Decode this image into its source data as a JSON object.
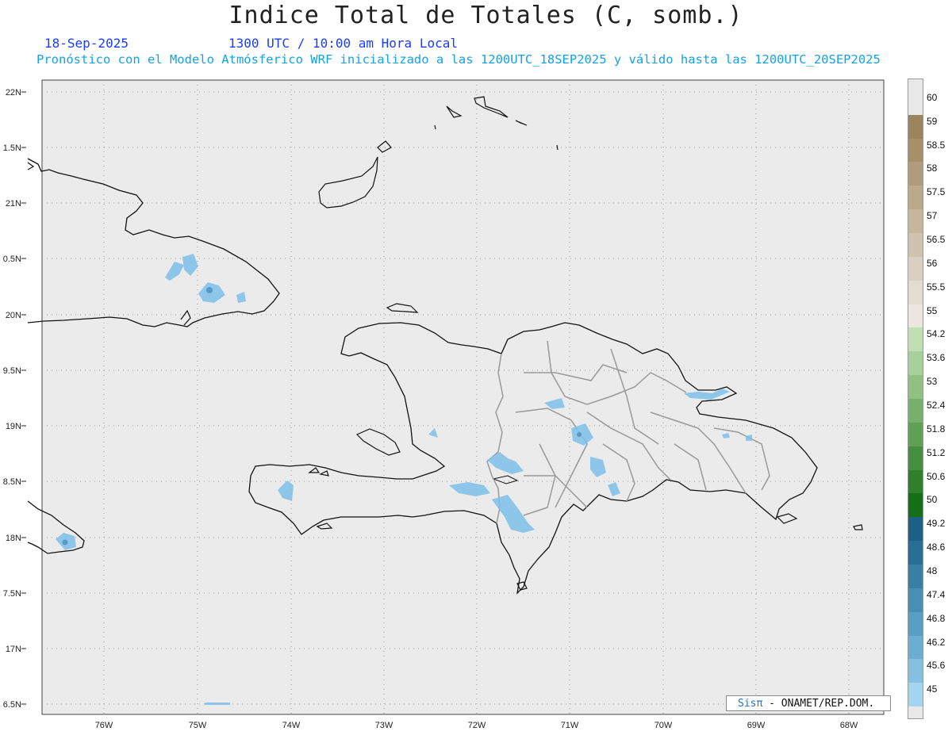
{
  "title": "Indice Total de Totales (C, somb.)",
  "date": "18-Sep-2025",
  "time": "1300 UTC / 10:00 am Hora Local",
  "description": "Pronóstico con el Modelo Atmósferico WRF inicializado a las 1200UTC_18SEP2025 y válido hasta las  1200UTC_20SEP2025",
  "credit": {
    "brand": "Sisπ",
    "rest": "- ONAMET/REP.DOM."
  },
  "lat_labels": [
    "22N",
    "1.5N",
    "21N",
    "0.5N",
    "20N",
    "9.5N",
    "19N",
    "8.5N",
    "18N",
    "7.5N",
    "17N",
    "6.5N"
  ],
  "lon_labels": [
    "76W",
    "75W",
    "74W",
    "73W",
    "72W",
    "71W",
    "70W",
    "69W",
    "68W"
  ],
  "legend": [
    {
      "label": "60",
      "color": "#e8e8e8"
    },
    {
      "label": "59",
      "color": "#9b8460"
    },
    {
      "label": "58.5",
      "color": "#a6906c"
    },
    {
      "label": "58",
      "color": "#b09c7c"
    },
    {
      "label": "57.5",
      "color": "#bba98b"
    },
    {
      "label": "57",
      "color": "#c5b69d"
    },
    {
      "label": "56.5",
      "color": "#cfc3af"
    },
    {
      "label": "56",
      "color": "#d9d0c1"
    },
    {
      "label": "55.5",
      "color": "#e2dcd1"
    },
    {
      "label": "55",
      "color": "#ebe7de"
    },
    {
      "label": "54.2",
      "color": "#bfe0b2"
    },
    {
      "label": "53.6",
      "color": "#a8d09a"
    },
    {
      "label": "53",
      "color": "#90c083"
    },
    {
      "label": "52.4",
      "color": "#77af6c"
    },
    {
      "label": "51.8",
      "color": "#5f9f56"
    },
    {
      "label": "51.2",
      "color": "#478f40"
    },
    {
      "label": "50.6",
      "color": "#2f7f2b"
    },
    {
      "label": "50",
      "color": "#176f17"
    },
    {
      "label": "49.2",
      "color": "#1e5f85"
    },
    {
      "label": "48.6",
      "color": "#2b6e95"
    },
    {
      "label": "48",
      "color": "#3a7ea4"
    },
    {
      "label": "47.4",
      "color": "#4a8eb4"
    },
    {
      "label": "46.8",
      "color": "#5a9ec3"
    },
    {
      "label": "46.2",
      "color": "#6baed2"
    },
    {
      "label": "45.6",
      "color": "#85c0e0"
    },
    {
      "label": "45",
      "color": "#a4d4ef"
    }
  ],
  "colors": {
    "map_bg": "#ebebeb",
    "coast": "#111111",
    "border": "#999999",
    "shade": "#7ec0ea"
  }
}
